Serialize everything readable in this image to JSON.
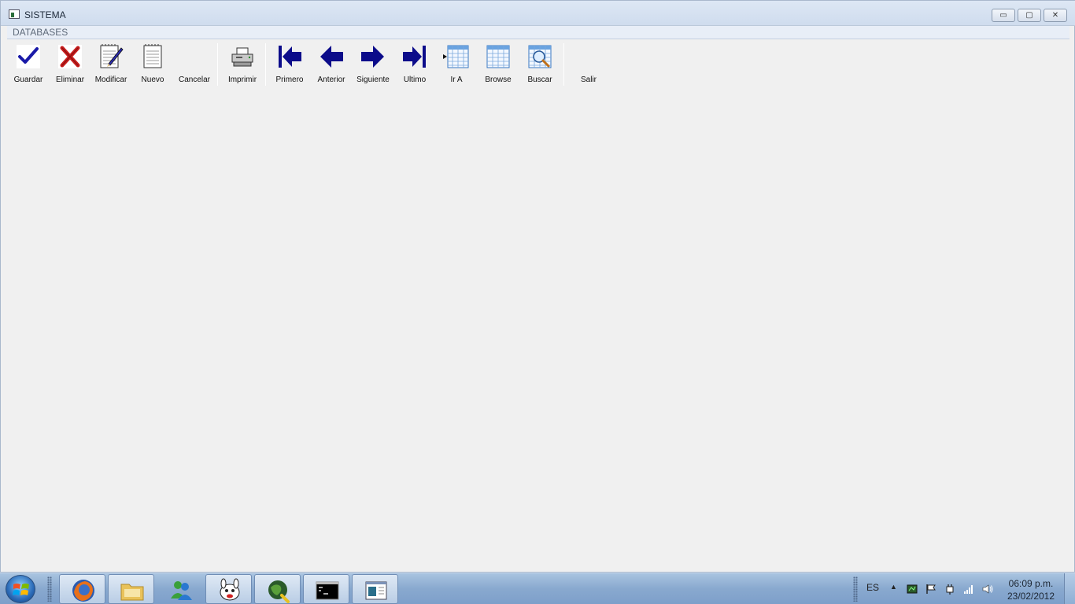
{
  "window": {
    "title": "SISTEMA",
    "controls": {
      "minimize": "▭",
      "maximize": "▢",
      "close": "✕"
    }
  },
  "menu": {
    "items": [
      "DATABASES"
    ]
  },
  "toolbar": {
    "buttons": [
      {
        "label": "Guardar",
        "icon": "checkmark-icon"
      },
      {
        "label": "Eliminar",
        "icon": "delete-x-icon"
      },
      {
        "label": "Modificar",
        "icon": "edit-notepad-icon"
      },
      {
        "label": "Nuevo",
        "icon": "new-notepad-icon"
      },
      {
        "label": "Cancelar",
        "icon": ""
      },
      {
        "label": "Imprimir",
        "icon": "printer-icon"
      },
      {
        "label": "Primero",
        "icon": "first-arrow-icon"
      },
      {
        "label": "Anterior",
        "icon": "previous-arrow-icon"
      },
      {
        "label": "Siguiente",
        "icon": "next-arrow-icon"
      },
      {
        "label": "Ultimo",
        "icon": "last-arrow-icon"
      },
      {
        "label": "Ir A",
        "icon": "goto-grid-icon"
      },
      {
        "label": "Browse",
        "icon": "browse-grid-icon"
      },
      {
        "label": "Buscar",
        "icon": "search-grid-icon"
      },
      {
        "label": "Salir",
        "icon": ""
      }
    ]
  },
  "taskbar": {
    "apps": [
      {
        "name": "firefox-icon"
      },
      {
        "name": "folder-icon"
      },
      {
        "name": "messenger-icon"
      },
      {
        "name": "cartoon-app-icon"
      },
      {
        "name": "globe-app-icon"
      },
      {
        "name": "command-prompt-icon"
      },
      {
        "name": "window-app-icon"
      }
    ],
    "language": "ES",
    "clock": {
      "time": "06:09 p.m.",
      "date": "23/02/2012"
    }
  },
  "colors": {
    "accent_blue": "#1a1aa8",
    "title_gradient": "#dde7f4",
    "taskbar": "#89a9cf"
  }
}
